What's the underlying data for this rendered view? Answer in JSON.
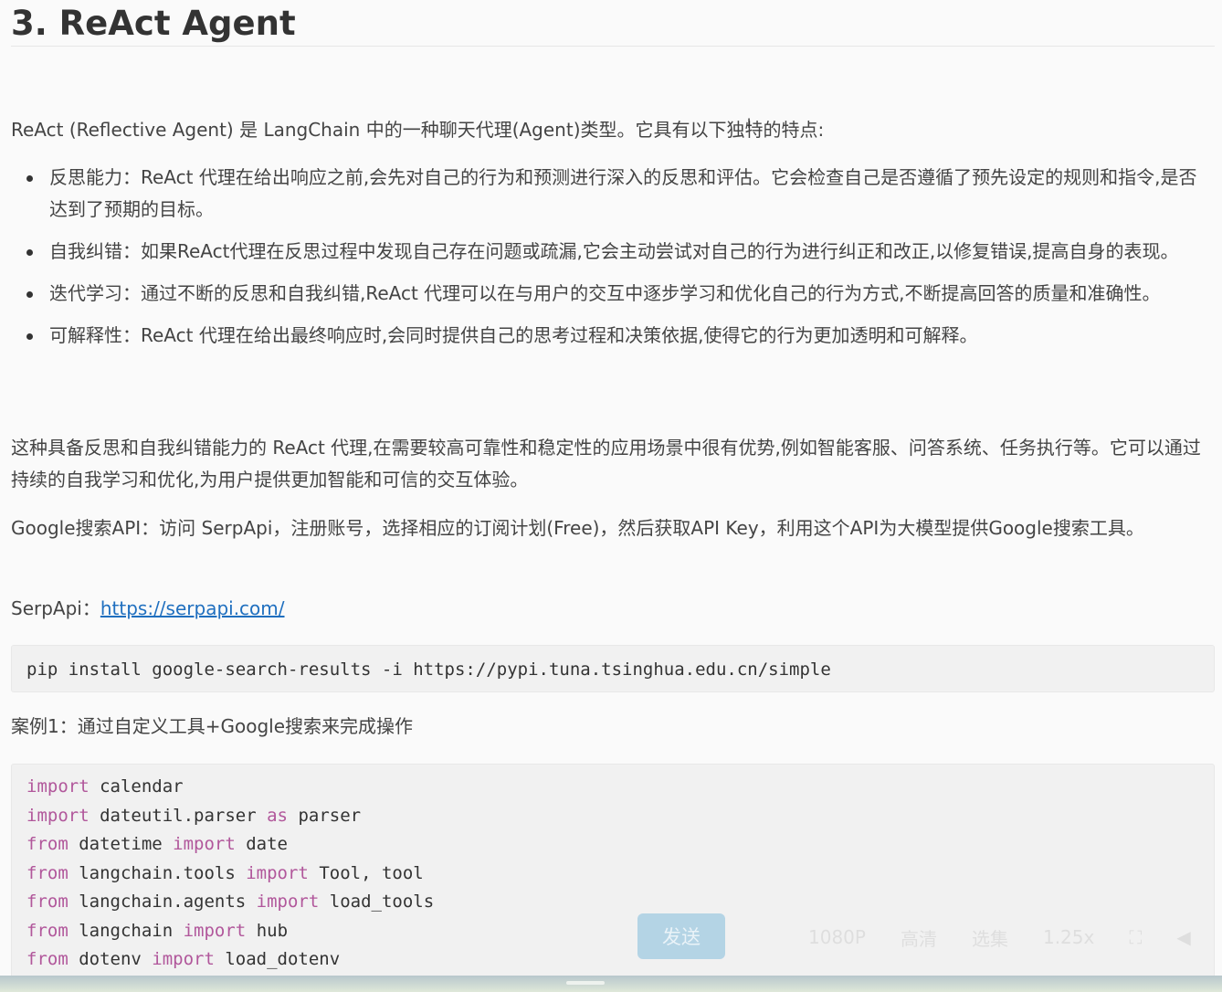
{
  "heading": "3. ReAct Agent",
  "intro": "ReAct (Reflective Agent) 是 LangChain 中的一种聊天代理(Agent)类型。它具有以下独特的特点:",
  "features": [
    "反思能力：ReAct 代理在给出响应之前,会先对自己的行为和预测进行深入的反思和评估。它会检查自己是否遵循了预先设定的规则和指令,是否达到了预期的目标。",
    "自我纠错：如果ReAct代理在反思过程中发现自己存在问题或疏漏,它会主动尝试对自己的行为进行纠正和改正,以修复错误,提高自身的表现。",
    "迭代学习：通过不断的反思和自我纠错,ReAct 代理可以在与用户的交互中逐步学习和优化自己的行为方式,不断提高回答的质量和准确性。",
    "可解释性：ReAct 代理在给出最终响应时,会同时提供自己的思考过程和决策依据,使得它的行为更加透明和可解释。"
  ],
  "summary": "这种具备反思和自我纠错能力的 ReAct 代理,在需要较高可靠性和稳定性的应用场景中很有优势,例如智能客服、问答系统、任务执行等。它可以通过持续的自我学习和优化,为用户提供更加智能和可信的交互体验。",
  "google_api": "Google搜索API：访问 SerpApi，注册账号，选择相应的订阅计划(Free)，然后获取API Key，利用这个API为大模型提供Google搜索工具。",
  "serpapi": {
    "label": "SerpApi：",
    "url": "https://serpapi.com/"
  },
  "pip_command": "pip install google-search-results -i https://pypi.tuna.tsinghua.edu.cn/simple",
  "case_title": "案例1：通过自定义工具+Google搜索来完成操作",
  "code_lines": [
    {
      "k1": "import",
      "m1": " calendar",
      "k2": "",
      "m2": ""
    },
    {
      "k1": "import",
      "m1": " dateutil.parser ",
      "k2": "as",
      "m2": " parser"
    },
    {
      "k1": "from",
      "m1": " datetime ",
      "k2": "import",
      "m2": " date"
    },
    {
      "k1": "from",
      "m1": " langchain.tools ",
      "k2": "import",
      "m2": " Tool, tool"
    },
    {
      "k1": "from",
      "m1": " langchain.agents ",
      "k2": "import",
      "m2": " load_tools"
    },
    {
      "k1": "from",
      "m1": " langchain ",
      "k2": "import",
      "m2": " hub"
    },
    {
      "k1": "from",
      "m1": " dotenv ",
      "k2": "import",
      "m2": " load_dotenv"
    }
  ],
  "send_button": "发送",
  "player_controls": [
    "1080P",
    "高清",
    "选集",
    "1.25x",
    "⛶",
    "◀"
  ],
  "colors": {
    "keyword": "#b1579b",
    "link": "#1f6fbf",
    "code_bg": "#f1f1f1",
    "send_button": "#aacfe4"
  }
}
